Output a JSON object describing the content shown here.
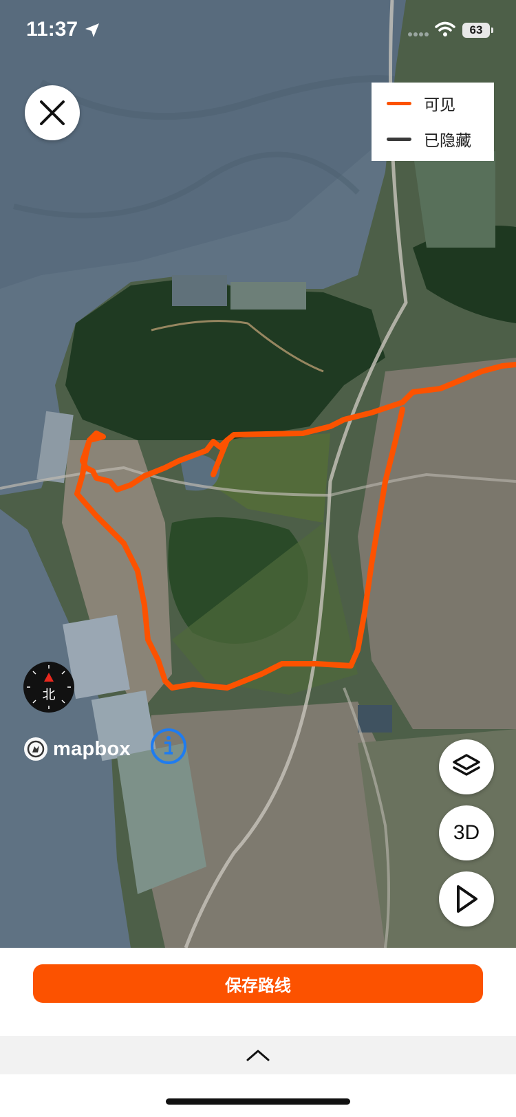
{
  "status_bar": {
    "time": "11:37",
    "battery": "63"
  },
  "legend": {
    "items": [
      {
        "label": "可见",
        "color": "#fc5200"
      },
      {
        "label": "已隐藏",
        "color": "#3a3a3a"
      }
    ]
  },
  "compass": {
    "label": "北"
  },
  "attribution": {
    "brand": "mapbox"
  },
  "map_controls": {
    "layers_icon": "layers-icon",
    "three_d_label": "3D",
    "play_icon": "play-icon"
  },
  "actions": {
    "save_route_label": "保存路线"
  },
  "colors": {
    "route": "#fc5200",
    "accent": "#fc5200",
    "info_blue": "#1f7cf0"
  }
}
